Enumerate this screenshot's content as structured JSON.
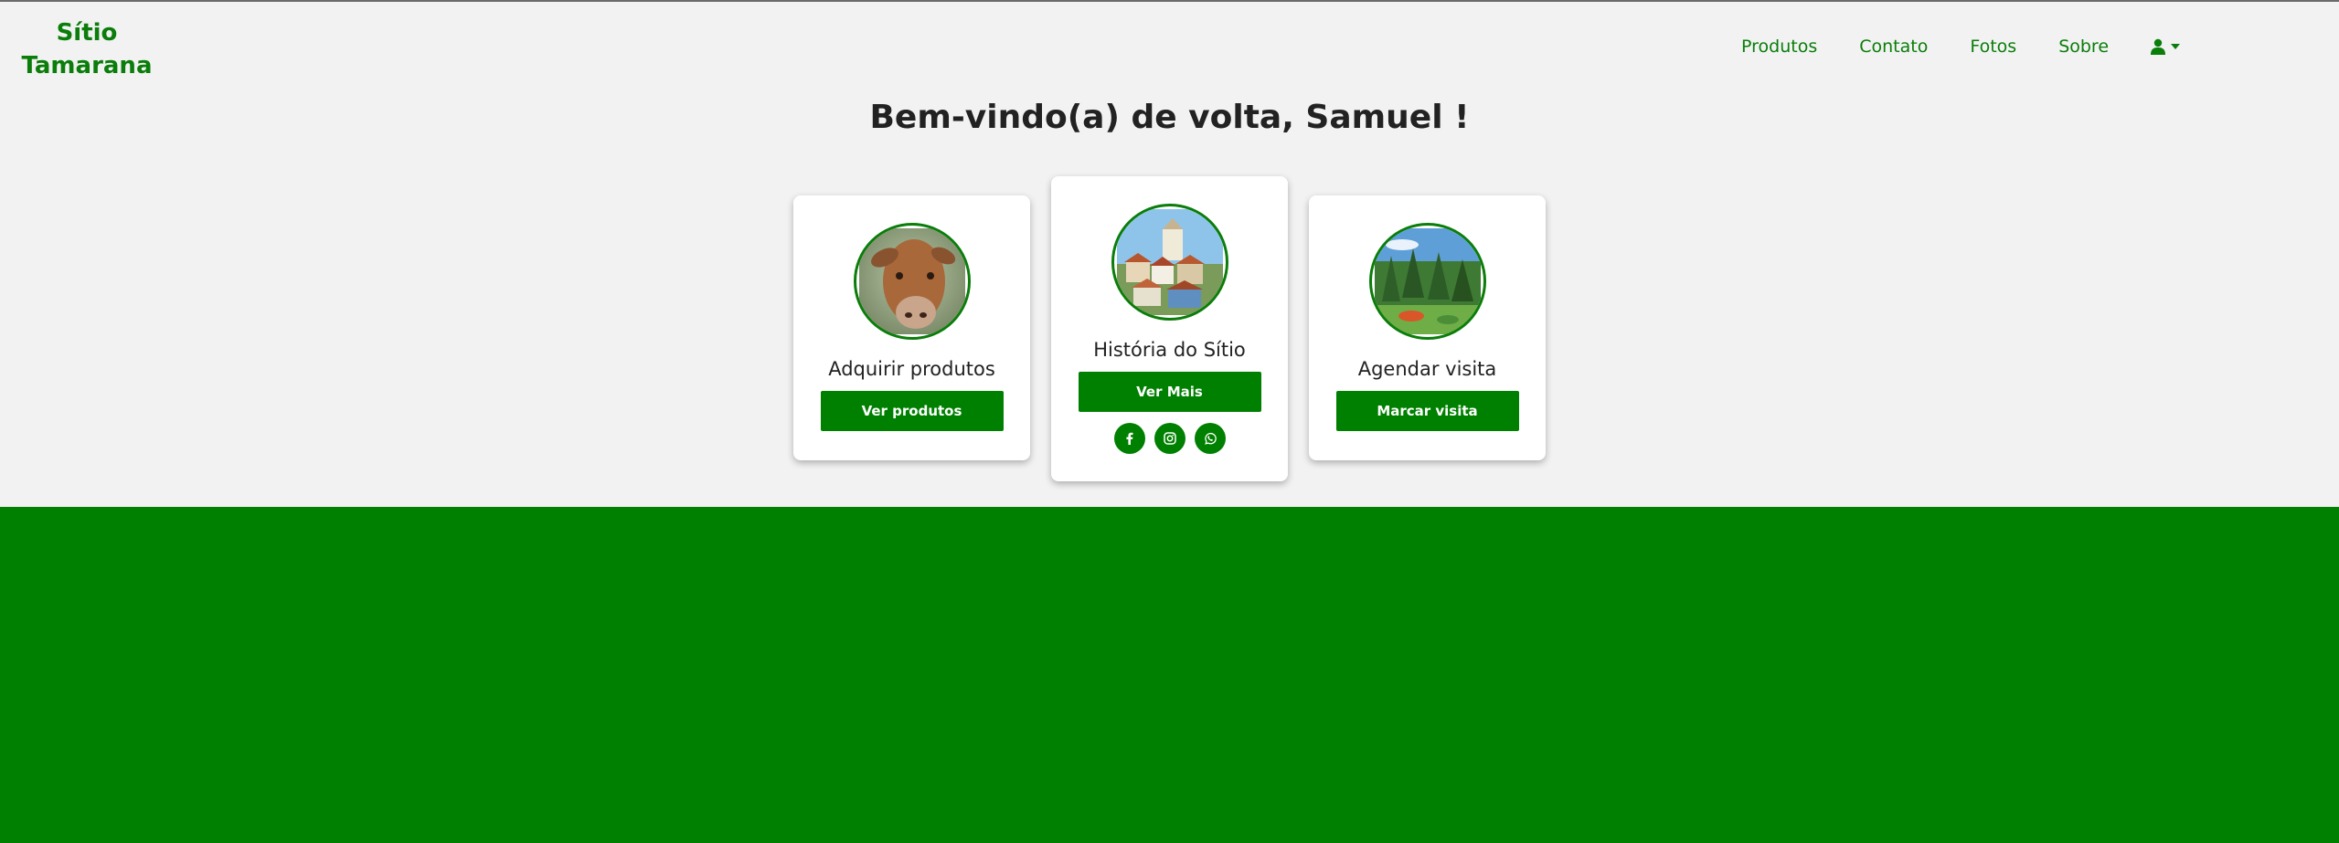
{
  "brand": {
    "name": "Sítio Tamarana"
  },
  "nav": {
    "items": [
      {
        "label": "Produtos"
      },
      {
        "label": "Contato"
      },
      {
        "label": "Fotos"
      },
      {
        "label": "Sobre"
      }
    ],
    "user_icon": "user-icon",
    "dropdown_icon": "caret-down-icon"
  },
  "welcome": {
    "text": "Bem-vindo(a) de volta, Samuel !"
  },
  "cards": [
    {
      "title": "Adquirir produtos",
      "button": "Ver produtos",
      "image": "cow-photo"
    },
    {
      "title": "História do Sítio",
      "button": "Ver Mais",
      "image": "town-photo",
      "social": [
        "facebook-icon",
        "instagram-icon",
        "whatsapp-icon"
      ]
    },
    {
      "title": "Agendar visita",
      "button": "Marcar visita",
      "image": "farm-photo"
    }
  ],
  "colors": {
    "accent": "#008000",
    "brand_text": "#0a7d0a",
    "background": "#f2f2f2",
    "footer": "#008000"
  }
}
